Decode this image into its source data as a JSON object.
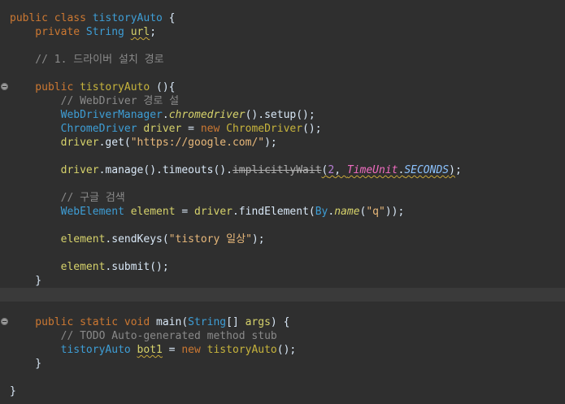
{
  "editor": {
    "lines": [
      {
        "tokens": [
          {
            "t": "public class ",
            "c": "kw"
          },
          {
            "t": "tistoryAuto",
            "c": "type"
          },
          {
            "t": " {",
            "c": "punc"
          }
        ]
      },
      {
        "tokens": [
          {
            "t": "    private ",
            "c": "kw"
          },
          {
            "t": "String",
            "c": "type"
          },
          {
            "t": " ",
            "c": "punc"
          },
          {
            "t": "url",
            "c": "var warn"
          },
          {
            "t": ";",
            "c": "punc"
          }
        ]
      },
      {
        "tokens": []
      },
      {
        "tokens": [
          {
            "t": "    // 1. 드라이버 설치 경로",
            "c": "cmt"
          }
        ]
      },
      {
        "tokens": []
      },
      {
        "fold": true,
        "tokens": [
          {
            "t": "    public ",
            "c": "kw"
          },
          {
            "t": "tistoryAuto",
            "c": "cls"
          },
          {
            "t": " (){",
            "c": "punc"
          }
        ]
      },
      {
        "tokens": [
          {
            "t": "        // WebDriver 경로 설",
            "c": "cmt"
          }
        ]
      },
      {
        "tokens": [
          {
            "t": "        ",
            "c": "punc"
          },
          {
            "t": "WebDriverManager",
            "c": "type"
          },
          {
            "t": ".",
            "c": "punc"
          },
          {
            "t": "chromedriver",
            "c": "static-method"
          },
          {
            "t": "().setup();",
            "c": "punc"
          }
        ]
      },
      {
        "tokens": [
          {
            "t": "        ",
            "c": "punc"
          },
          {
            "t": "ChromeDriver",
            "c": "type"
          },
          {
            "t": " ",
            "c": "punc"
          },
          {
            "t": "driver",
            "c": "var"
          },
          {
            "t": " = ",
            "c": "punc"
          },
          {
            "t": "new ",
            "c": "kw"
          },
          {
            "t": "ChromeDriver",
            "c": "cls"
          },
          {
            "t": "();",
            "c": "punc"
          }
        ]
      },
      {
        "tokens": [
          {
            "t": "        ",
            "c": "punc"
          },
          {
            "t": "driver",
            "c": "var"
          },
          {
            "t": ".get(",
            "c": "punc"
          },
          {
            "t": "\"https://google.com/\"",
            "c": "str"
          },
          {
            "t": ");",
            "c": "punc"
          }
        ]
      },
      {
        "tokens": []
      },
      {
        "tokens": [
          {
            "t": "        ",
            "c": "punc"
          },
          {
            "t": "driver",
            "c": "var"
          },
          {
            "t": ".manage().timeouts().",
            "c": "punc"
          },
          {
            "t": "implicitlyWait",
            "c": "deprecated warn"
          },
          {
            "t": "(",
            "c": "punc warn"
          },
          {
            "t": "2",
            "c": "num warn"
          },
          {
            "t": ", ",
            "c": "punc warn"
          },
          {
            "t": "TimeUnit",
            "c": "static-field warn"
          },
          {
            "t": ".",
            "c": "punc warn"
          },
          {
            "t": "SECONDS",
            "c": "const warn"
          },
          {
            "t": ")",
            "c": "punc warn"
          },
          {
            "t": ";",
            "c": "punc"
          }
        ]
      },
      {
        "tokens": []
      },
      {
        "tokens": [
          {
            "t": "        // 구글 검색",
            "c": "cmt"
          }
        ]
      },
      {
        "tokens": [
          {
            "t": "        ",
            "c": "punc"
          },
          {
            "t": "WebElement",
            "c": "type"
          },
          {
            "t": " ",
            "c": "punc"
          },
          {
            "t": "element",
            "c": "var"
          },
          {
            "t": " = ",
            "c": "punc"
          },
          {
            "t": "driver",
            "c": "var"
          },
          {
            "t": ".findElement(",
            "c": "punc"
          },
          {
            "t": "By",
            "c": "type"
          },
          {
            "t": ".",
            "c": "punc"
          },
          {
            "t": "name",
            "c": "static-method"
          },
          {
            "t": "(",
            "c": "punc"
          },
          {
            "t": "\"q\"",
            "c": "str"
          },
          {
            "t": "));",
            "c": "punc"
          }
        ]
      },
      {
        "tokens": []
      },
      {
        "tokens": [
          {
            "t": "        ",
            "c": "punc"
          },
          {
            "t": "element",
            "c": "var"
          },
          {
            "t": ".sendKeys(",
            "c": "punc"
          },
          {
            "t": "\"tistory 일상\"",
            "c": "str"
          },
          {
            "t": ");",
            "c": "punc"
          }
        ]
      },
      {
        "tokens": []
      },
      {
        "tokens": [
          {
            "t": "        ",
            "c": "punc"
          },
          {
            "t": "element",
            "c": "var"
          },
          {
            "t": ".submit();",
            "c": "punc"
          }
        ]
      },
      {
        "tokens": [
          {
            "t": "    }",
            "c": "punc"
          }
        ]
      },
      {
        "current": true,
        "tokens": []
      },
      {
        "tokens": []
      },
      {
        "fold": true,
        "tokens": [
          {
            "t": "    public static void ",
            "c": "kw"
          },
          {
            "t": "main",
            "c": "fn"
          },
          {
            "t": "(",
            "c": "punc"
          },
          {
            "t": "String",
            "c": "type"
          },
          {
            "t": "[] ",
            "c": "punc"
          },
          {
            "t": "args",
            "c": "var"
          },
          {
            "t": ") {",
            "c": "punc"
          }
        ]
      },
      {
        "tokens": [
          {
            "t": "        // TODO Auto-generated method stub",
            "c": "cmt"
          }
        ]
      },
      {
        "tokens": [
          {
            "t": "        ",
            "c": "punc"
          },
          {
            "t": "tistoryAuto",
            "c": "type"
          },
          {
            "t": " ",
            "c": "punc"
          },
          {
            "t": "bot1",
            "c": "var warn"
          },
          {
            "t": " = ",
            "c": "punc"
          },
          {
            "t": "new ",
            "c": "kw"
          },
          {
            "t": "tistoryAuto",
            "c": "cls"
          },
          {
            "t": "();",
            "c": "punc"
          }
        ]
      },
      {
        "tokens": [
          {
            "t": "    }",
            "c": "punc"
          }
        ]
      },
      {
        "tokens": []
      },
      {
        "tokens": [
          {
            "t": "}",
            "c": "punc"
          }
        ]
      }
    ]
  }
}
